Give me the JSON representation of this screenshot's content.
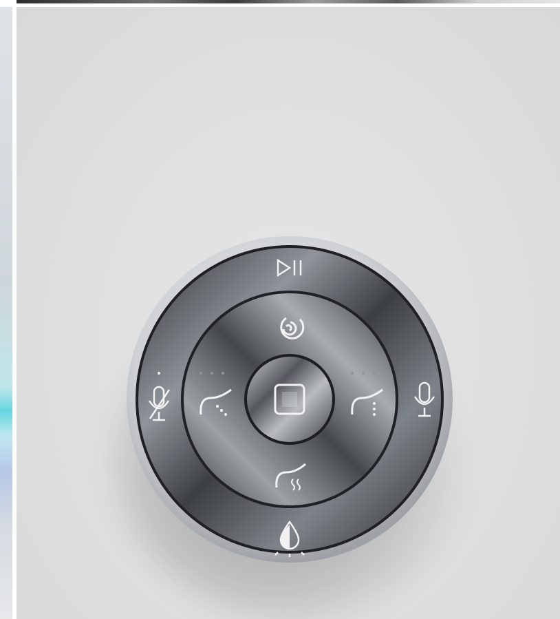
{
  "photo": {
    "subject": "controller-dial",
    "colors": {
      "background": "#dedede",
      "metal_dark": "#3e4145",
      "metal_light": "#c9ccd0",
      "rim": "#d9dcdf",
      "icon": "#f2f2f2"
    }
  },
  "controls": {
    "outer_ring": [
      {
        "icon": "play-pause-icon"
      },
      {
        "icon": "mic-icon"
      },
      {
        "icon": "light-drop-icon"
      },
      {
        "icon": "mic-muted-icon"
      }
    ],
    "middle_ring": [
      {
        "icon": "swirl-icon"
      },
      {
        "icon": "wave-right-icon"
      },
      {
        "icon": "steam-wave-icon"
      },
      {
        "icon": "wave-left-icon"
      }
    ],
    "center": {
      "icon": "stop-square-icon"
    }
  }
}
